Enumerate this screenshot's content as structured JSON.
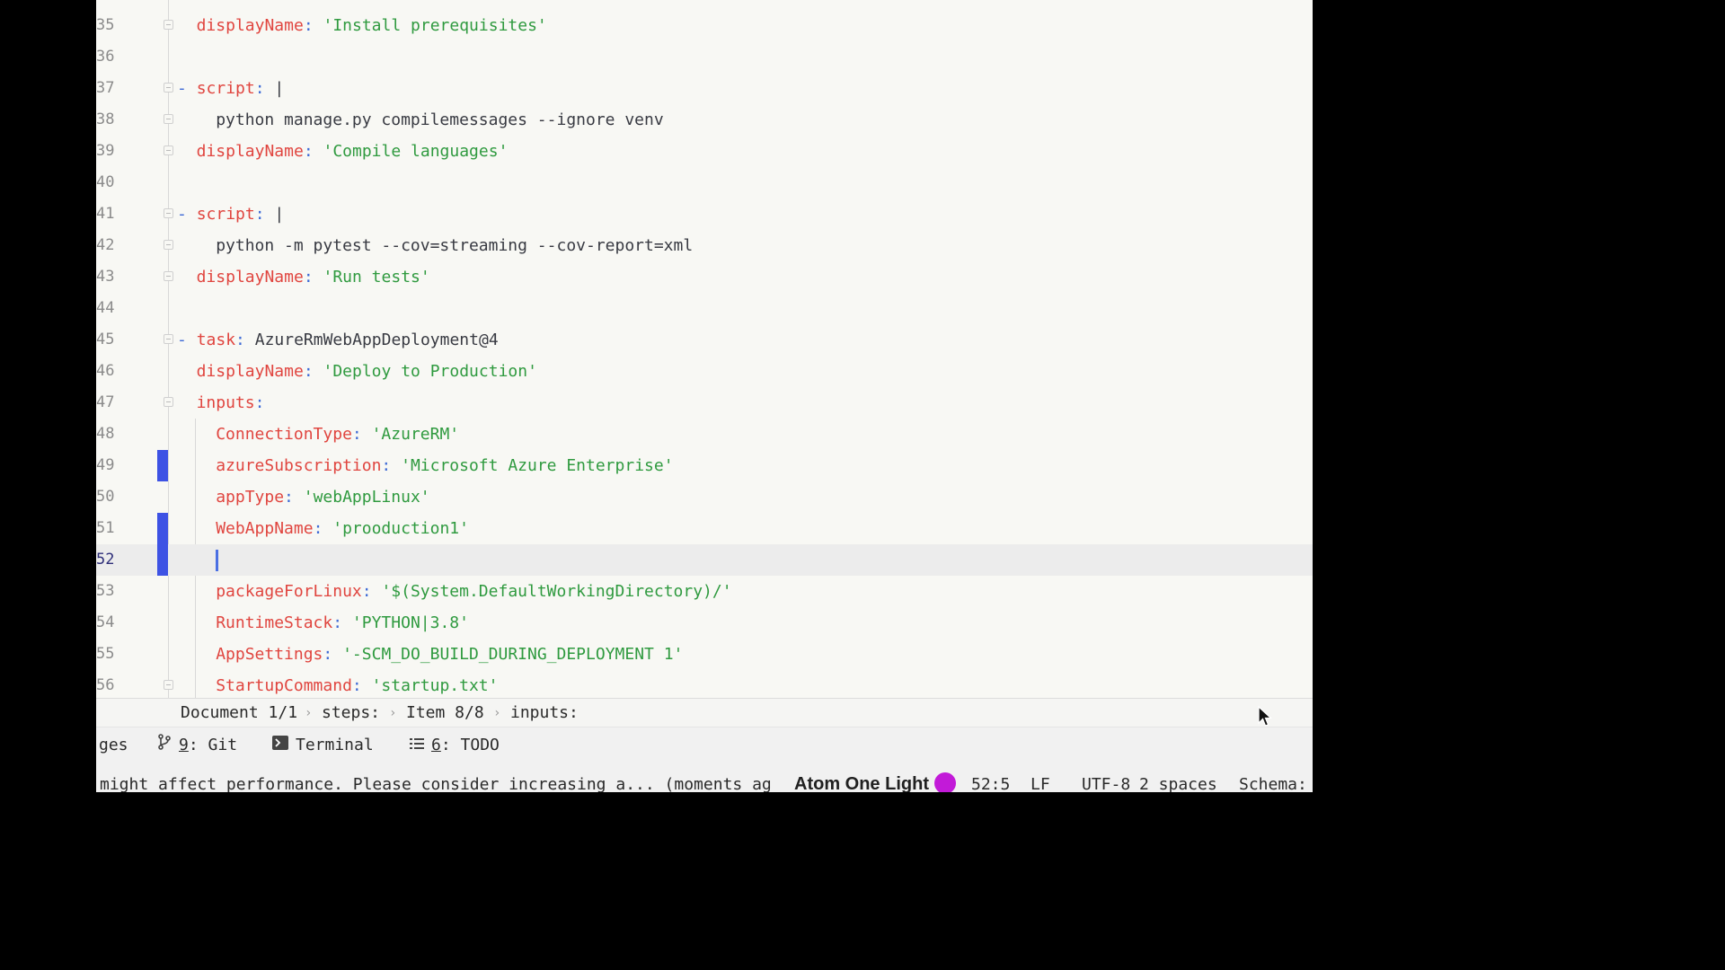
{
  "editor": {
    "lines": [
      {
        "n": "35",
        "fold": true,
        "change": false,
        "current": false,
        "indent": 2,
        "parts": [
          {
            "c": "k",
            "t": "displayName"
          },
          {
            "c": "p",
            "t": ": "
          },
          {
            "c": "s",
            "t": "'Install prerequisites'"
          }
        ]
      },
      {
        "n": "36",
        "fold": false,
        "change": false,
        "current": false,
        "indent": 0,
        "parts": []
      },
      {
        "n": "37",
        "fold": true,
        "change": false,
        "current": false,
        "indent": 0,
        "parts": [
          {
            "c": "p",
            "t": "- "
          },
          {
            "c": "k",
            "t": "script"
          },
          {
            "c": "p",
            "t": ": "
          },
          {
            "c": "t",
            "t": "|"
          }
        ]
      },
      {
        "n": "38",
        "fold": true,
        "change": false,
        "current": false,
        "indent": 4,
        "parts": [
          {
            "c": "t",
            "t": "python manage.py compilemessages --ignore venv"
          }
        ]
      },
      {
        "n": "39",
        "fold": true,
        "change": false,
        "current": false,
        "indent": 2,
        "parts": [
          {
            "c": "k",
            "t": "displayName"
          },
          {
            "c": "p",
            "t": ": "
          },
          {
            "c": "s",
            "t": "'Compile languages'"
          }
        ]
      },
      {
        "n": "40",
        "fold": false,
        "change": false,
        "current": false,
        "indent": 0,
        "parts": []
      },
      {
        "n": "41",
        "fold": true,
        "change": false,
        "current": false,
        "indent": 0,
        "parts": [
          {
            "c": "p",
            "t": "- "
          },
          {
            "c": "k",
            "t": "script"
          },
          {
            "c": "p",
            "t": ": "
          },
          {
            "c": "t",
            "t": "|"
          }
        ]
      },
      {
        "n": "42",
        "fold": true,
        "change": false,
        "current": false,
        "indent": 4,
        "parts": [
          {
            "c": "t",
            "t": "python -m pytest --cov=streaming --cov-report=xml"
          }
        ]
      },
      {
        "n": "43",
        "fold": true,
        "change": false,
        "current": false,
        "indent": 2,
        "parts": [
          {
            "c": "k",
            "t": "displayName"
          },
          {
            "c": "p",
            "t": ": "
          },
          {
            "c": "s",
            "t": "'Run tests'"
          }
        ]
      },
      {
        "n": "44",
        "fold": false,
        "change": false,
        "current": false,
        "indent": 0,
        "parts": []
      },
      {
        "n": "45",
        "fold": true,
        "change": false,
        "current": false,
        "indent": 0,
        "parts": [
          {
            "c": "p",
            "t": "- "
          },
          {
            "c": "k",
            "t": "task"
          },
          {
            "c": "p",
            "t": ": "
          },
          {
            "c": "t",
            "t": "AzureRmWebAppDeployment@4"
          }
        ]
      },
      {
        "n": "46",
        "fold": false,
        "change": false,
        "current": false,
        "indent": 2,
        "parts": [
          {
            "c": "k",
            "t": "displayName"
          },
          {
            "c": "p",
            "t": ": "
          },
          {
            "c": "s",
            "t": "'Deploy to Production'"
          }
        ]
      },
      {
        "n": "47",
        "fold": true,
        "change": false,
        "current": false,
        "indent": 2,
        "parts": [
          {
            "c": "k",
            "t": "inputs"
          },
          {
            "c": "p",
            "t": ":"
          }
        ]
      },
      {
        "n": "48",
        "fold": false,
        "change": false,
        "current": false,
        "indent": 4,
        "parts": [
          {
            "c": "k",
            "t": "ConnectionType"
          },
          {
            "c": "p",
            "t": ": "
          },
          {
            "c": "s",
            "t": "'AzureRM'"
          }
        ]
      },
      {
        "n": "49",
        "fold": false,
        "change": true,
        "current": false,
        "indent": 4,
        "parts": [
          {
            "c": "k",
            "t": "azureSubscription"
          },
          {
            "c": "p",
            "t": ": "
          },
          {
            "c": "s",
            "t": "'Microsoft Azure Enterprise'"
          }
        ]
      },
      {
        "n": "50",
        "fold": false,
        "change": false,
        "current": false,
        "indent": 4,
        "parts": [
          {
            "c": "k",
            "t": "appType"
          },
          {
            "c": "p",
            "t": ": "
          },
          {
            "c": "s",
            "t": "'webAppLinux'"
          }
        ]
      },
      {
        "n": "51",
        "fold": false,
        "change": true,
        "current": false,
        "indent": 4,
        "parts": [
          {
            "c": "k",
            "t": "WebAppName"
          },
          {
            "c": "p",
            "t": ": "
          },
          {
            "c": "s",
            "t": "'prooduction1'"
          }
        ]
      },
      {
        "n": "52",
        "fold": false,
        "change": true,
        "current": true,
        "indent": 4,
        "cursor": true,
        "parts": []
      },
      {
        "n": "53",
        "fold": false,
        "change": false,
        "current": false,
        "indent": 4,
        "parts": [
          {
            "c": "k",
            "t": "packageForLinux"
          },
          {
            "c": "p",
            "t": ": "
          },
          {
            "c": "s",
            "t": "'$(System.DefaultWorkingDirectory)/'"
          }
        ]
      },
      {
        "n": "54",
        "fold": false,
        "change": false,
        "current": false,
        "indent": 4,
        "parts": [
          {
            "c": "k",
            "t": "RuntimeStack"
          },
          {
            "c": "p",
            "t": ": "
          },
          {
            "c": "s",
            "t": "'PYTHON|3.8'"
          }
        ]
      },
      {
        "n": "55",
        "fold": false,
        "change": false,
        "current": false,
        "indent": 4,
        "parts": [
          {
            "c": "k",
            "t": "AppSettings"
          },
          {
            "c": "p",
            "t": ": "
          },
          {
            "c": "s",
            "t": "'-SCM_DO_BUILD_DURING_DEPLOYMENT 1'"
          }
        ]
      },
      {
        "n": "56",
        "fold": true,
        "change": false,
        "current": false,
        "indent": 4,
        "parts": [
          {
            "c": "k",
            "t": "StartupCommand"
          },
          {
            "c": "p",
            "t": ": "
          },
          {
            "c": "s",
            "t": "'startup.txt'"
          }
        ]
      }
    ]
  },
  "breadcrumb": {
    "items": [
      "Document 1/1",
      "steps:",
      "Item 8/8",
      "inputs:"
    ],
    "separator": "›"
  },
  "toolwindows": {
    "changes_partial": "ges",
    "git": {
      "number": "9",
      "label": ": Git"
    },
    "terminal": {
      "label": "Terminal"
    },
    "todo": {
      "number": "6",
      "label": ": TODO"
    }
  },
  "status": {
    "message": "might affect performance. Please consider increasing a... (moments ag",
    "theme": "Atom One Light",
    "theme_color": "#c21ad8",
    "position": "52:5",
    "line_separator": "LF",
    "encoding": "UTF-8",
    "indent": "2 spaces",
    "schema": "Schema:"
  }
}
